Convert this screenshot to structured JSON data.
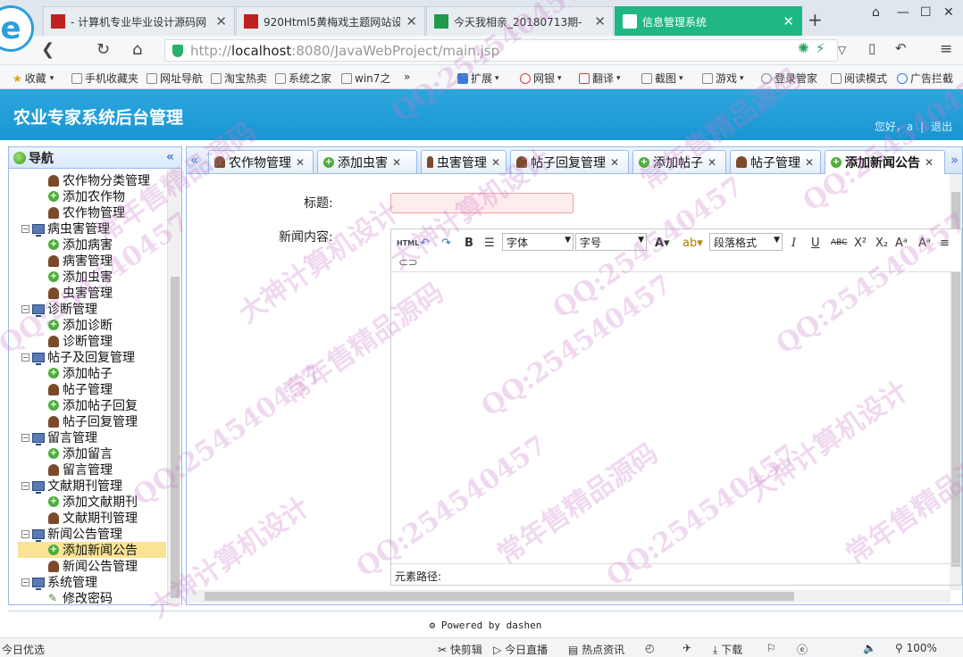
{
  "browser": {
    "tabs": [
      {
        "label": "- 计算机专业毕业设计源码网",
        "favicon_color": "#c0201e"
      },
      {
        "label": "920Html5黄梅戏主题网站设",
        "favicon_color": "#c0201e"
      },
      {
        "label": "今天我相亲_20180713期-",
        "favicon_color": "#1e9a4a"
      },
      {
        "label": "信息管理系统",
        "favicon_color": "#ffffff",
        "active": true
      }
    ],
    "url_prefix": "http://",
    "url_host": "localhost",
    "url_rest": ":8080/JavaWebProject/main.jsp",
    "bookmarks": [
      "收藏",
      "手机收藏夹",
      "网址导航",
      "淘宝热卖",
      "系统之家",
      "win7之",
      "扩展",
      "网银",
      "翻译",
      "截图",
      "游戏",
      "登录管家",
      "阅读模式",
      "广告拦截"
    ]
  },
  "app": {
    "title": "农业专家系统后台管理",
    "greeting": "您好，a",
    "logout": "退出"
  },
  "nav": {
    "title": "导航",
    "items": [
      {
        "label": "农作物分类管理",
        "level": 2,
        "icon": "person"
      },
      {
        "label": "添加农作物",
        "level": 2,
        "icon": "add"
      },
      {
        "label": "农作物管理",
        "level": 2,
        "icon": "person"
      },
      {
        "label": "病虫害管理",
        "level": 1,
        "icon": "pc"
      },
      {
        "label": "添加病害",
        "level": 2,
        "icon": "add"
      },
      {
        "label": "病害管理",
        "level": 2,
        "icon": "person"
      },
      {
        "label": "添加虫害",
        "level": 2,
        "icon": "add"
      },
      {
        "label": "虫害管理",
        "level": 2,
        "icon": "person"
      },
      {
        "label": "诊断管理",
        "level": 1,
        "icon": "pc"
      },
      {
        "label": "添加诊断",
        "level": 2,
        "icon": "add"
      },
      {
        "label": "诊断管理",
        "level": 2,
        "icon": "person"
      },
      {
        "label": "帖子及回复管理",
        "level": 1,
        "icon": "pc"
      },
      {
        "label": "添加帖子",
        "level": 2,
        "icon": "add"
      },
      {
        "label": "帖子管理",
        "level": 2,
        "icon": "person"
      },
      {
        "label": "添加帖子回复",
        "level": 2,
        "icon": "add"
      },
      {
        "label": "帖子回复管理",
        "level": 2,
        "icon": "person"
      },
      {
        "label": "留言管理",
        "level": 1,
        "icon": "pc"
      },
      {
        "label": "添加留言",
        "level": 2,
        "icon": "add"
      },
      {
        "label": "留言管理",
        "level": 2,
        "icon": "person"
      },
      {
        "label": "文献期刊管理",
        "level": 1,
        "icon": "pc"
      },
      {
        "label": "添加文献期刊",
        "level": 2,
        "icon": "add"
      },
      {
        "label": "文献期刊管理",
        "level": 2,
        "icon": "person"
      },
      {
        "label": "新闻公告管理",
        "level": 1,
        "icon": "pc"
      },
      {
        "label": "添加新闻公告",
        "level": 2,
        "icon": "add",
        "selected": true
      },
      {
        "label": "新闻公告管理",
        "level": 2,
        "icon": "person"
      },
      {
        "label": "系统管理",
        "level": 1,
        "icon": "pc"
      },
      {
        "label": "修改密码",
        "level": 2,
        "icon": "pen"
      }
    ]
  },
  "main_tabs": [
    {
      "label": "农作物管理",
      "icon": "person"
    },
    {
      "label": "添加虫害",
      "icon": "add"
    },
    {
      "label": "虫害管理",
      "icon": "person"
    },
    {
      "label": "帖子回复管理",
      "icon": "person"
    },
    {
      "label": "添加帖子",
      "icon": "add"
    },
    {
      "label": "帖子管理",
      "icon": "person"
    },
    {
      "label": "添加新闻公告",
      "icon": "add",
      "active": true
    }
  ],
  "form": {
    "title_label": "标题:",
    "title_value": "",
    "content_label": "新闻内容:",
    "font_select": "字体",
    "size_select": "字号",
    "paragraph_select": "段落格式",
    "element_path": "元素路径:"
  },
  "footer": "Powered by dashen",
  "statusbar": [
    "今日优选",
    "快剪辑",
    "今日直播",
    "热点资讯",
    "下载",
    "100%"
  ],
  "watermark": [
    "QQ:254540457",
    "大神计算机设计",
    "常年售精品源码"
  ]
}
